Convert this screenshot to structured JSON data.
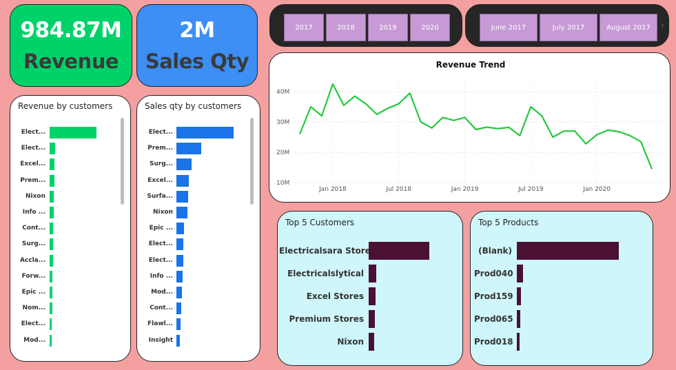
{
  "kpis": {
    "revenue": {
      "value": "984.87M",
      "label": "Revenue",
      "color": "#00d26a"
    },
    "sales_qty": {
      "value": "2M",
      "label": "Sales Qty",
      "color": "#3d8ef5"
    }
  },
  "year_slicer": [
    "2017",
    "2018",
    "2019",
    "2020"
  ],
  "month_slicer": [
    "June 2017",
    "July 2017",
    "August 2017"
  ],
  "month_slicer_next_icon": "chevron-right-icon",
  "colors": {
    "green": "#00d26a",
    "blue": "#1a73e8",
    "maroon": "#4a1133",
    "line": "#22c93c",
    "background": "#f4a0a0"
  },
  "chart_data": [
    {
      "id": "revenue_by_customers",
      "type": "bar",
      "orientation": "horizontal",
      "title": "Revenue by customers",
      "categories": [
        "Elect...",
        "Elect...",
        "Excel...",
        "Prem...",
        "Nixon",
        "Info ...",
        "Cont...",
        "Surg...",
        "Accla...",
        "Forw...",
        "Epic ...",
        "Nom...",
        "Elect...",
        "Mod..."
      ],
      "values": [
        100,
        12,
        11,
        10,
        9,
        8.5,
        8,
        7.5,
        7,
        6.5,
        6,
        5.5,
        5,
        4.5
      ]
    },
    {
      "id": "sales_qty_by_customers",
      "type": "bar",
      "orientation": "horizontal",
      "title": "Sales qty by customers",
      "categories": [
        "Elect...",
        "Prem...",
        "Surg...",
        "Excel...",
        "Surfa...",
        "Nixon",
        "Epic ...",
        "Elect...",
        "Elect...",
        "Info ...",
        "Mod...",
        "Cont...",
        "Flawl...",
        "Insight"
      ],
      "values": [
        100,
        43,
        27,
        22,
        20,
        19,
        13,
        12,
        12,
        11,
        10,
        8,
        7,
        6
      ]
    },
    {
      "id": "revenue_trend",
      "type": "line",
      "title": "Revenue Trend",
      "x_ticks": [
        "Jan 2018",
        "Jul 2018",
        "Jan 2019",
        "Jul 2019",
        "Jan 2020"
      ],
      "y_ticks": [
        "10M",
        "20M",
        "30M",
        "40M"
      ],
      "ylim": [
        10,
        40
      ],
      "x": [
        "Oct 2017",
        "Nov 2017",
        "Dec 2017",
        "Jan 2018",
        "Feb 2018",
        "Mar 2018",
        "Apr 2018",
        "May 2018",
        "Jun 2018",
        "Jul 2018",
        "Aug 2018",
        "Sep 2018",
        "Oct 2018",
        "Nov 2018",
        "Dec 2018",
        "Jan 2019",
        "Feb 2019",
        "Mar 2019",
        "Apr 2019",
        "May 2019",
        "Jun 2019",
        "Jul 2019",
        "Aug 2019",
        "Sep 2019",
        "Oct 2019",
        "Nov 2019",
        "Dec 2019",
        "Jan 2020",
        "Feb 2020",
        "Mar 2020",
        "Apr 2020",
        "May 2020",
        "Jun 2020"
      ],
      "values": [
        26,
        35,
        32,
        42.5,
        35.5,
        38.5,
        36,
        32.5,
        34.5,
        36,
        39.5,
        30,
        28,
        31.5,
        30.5,
        31.5,
        27.5,
        28.3,
        27.8,
        28.2,
        25.5,
        35,
        32,
        25,
        27,
        27,
        22.8,
        25.8,
        27.3,
        26.8,
        25.5,
        23.5,
        14.5
      ]
    },
    {
      "id": "top5_customers",
      "type": "bar",
      "orientation": "horizontal",
      "title": "Top 5 Customers",
      "categories": [
        "Electricalsara Stores",
        "Electricalslytical",
        "Excel Stores",
        "Premium Stores",
        "Nixon"
      ],
      "values": [
        100,
        12,
        11,
        10,
        9
      ]
    },
    {
      "id": "top5_products",
      "type": "bar",
      "orientation": "horizontal",
      "title": "Top 5 Products",
      "categories": [
        "(Blank)",
        "Prod040",
        "Prod159",
        "Prod065",
        "Prod018"
      ],
      "values": [
        100,
        6,
        4,
        3.5,
        3
      ]
    }
  ]
}
